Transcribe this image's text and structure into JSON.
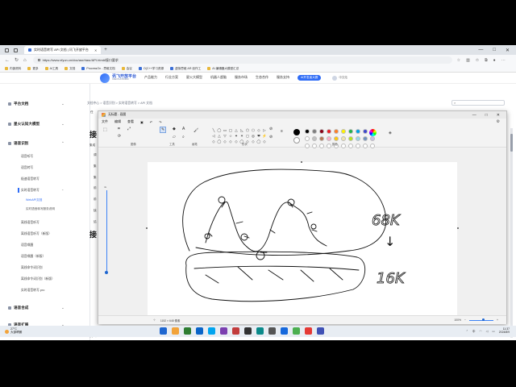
{
  "browser": {
    "tab_title": "实时语音转写 API 文档 | 讯飞开放平台",
    "new_tab_symbol": "+",
    "window_controls": [
      "—",
      "□",
      "✕"
    ],
    "url": "https://www.xfyun.cn/doc/asr/rtasr/API.html#接口要求",
    "nav_icons": [
      "back-icon",
      "forward-icon",
      "refresh-icon",
      "home-icon"
    ],
    "bookmarks": [
      "内部资料",
      "更多",
      "AI工具",
      "文档",
      "ProcessOn - 思维文档",
      "会议",
      "O(C++学习资源",
      "虚拟思维 AR 创作工",
      "AI 编辑器大模型汇总"
    ]
  },
  "site": {
    "logo_title": "讯飞开放平台",
    "logo_subtitle": "XFEI PLATFORM",
    "nav": [
      "产品能力",
      "行业方案",
      "星火大模型",
      "机器人超脑",
      "服务市场",
      "生态合作",
      "服务支持"
    ],
    "hot_label": "AI开发者大赛",
    "switch_label": "中文站"
  },
  "sidebar": {
    "sections": [
      {
        "label": "平台文档",
        "expanded": false
      },
      {
        "label": "星火认知大模型",
        "expanded": false
      },
      {
        "label": "语音识别",
        "expanded": true
      },
      {
        "label": "语音合成",
        "expanded": false
      },
      {
        "label": "语音扩展",
        "expanded": false
      }
    ],
    "asr_items": [
      "语音听写",
      "语音转写",
      "极速语音转写",
      "实时语音转写",
      "离线语音听写",
      "离线语音听写（新版）",
      "语音唤醒",
      "语音唤醒（新版）",
      "离线命令词识别",
      "离线命令词识别（新版）",
      "实时语音转写.pro"
    ],
    "active_children": [
      "WebAPI文档",
      "实时语音转写服务说明"
    ]
  },
  "content": {
    "breadcrumb": "文档中心 > 语音识别 > 实时语音转写 > API 文档",
    "search_icon": "search-icon",
    "heading_1": "接",
    "heading_2": "接",
    "heading_3": "接",
    "side_chars": [
      "集成",
      "调",
      "集",
      "集",
      "前",
      "前",
      "缺",
      "结"
    ],
    "prefix_1": "任",
    "prefix_2": "@",
    "prefix_3": "实时"
  },
  "paint": {
    "title": "无标题 - 画图",
    "window_controls": [
      "—",
      "□",
      "✕"
    ],
    "menu": [
      "文件",
      "编辑",
      "查看"
    ],
    "ribbon_labels": [
      "图像",
      "工具",
      "画笔",
      "形状",
      "颜色"
    ],
    "zoom_label": "4x",
    "status_dimensions": "1152 × 648 像素",
    "zoom_value": "100%",
    "palette": [
      "#000000",
      "#7f7f7f",
      "#880015",
      "#ed1c24",
      "#ff7f27",
      "#fff200",
      "#22b14c",
      "#00a2e8",
      "#3f48cc",
      "#a349a4",
      "#ffffff",
      "#c3c3c3",
      "#b97a57",
      "#ffaec9",
      "#ffc90e",
      "#efe4b0",
      "#b5e61d",
      "#99d9ea",
      "#7092be",
      "#c8bfe7",
      "#ffffff",
      "#ffffff",
      "#ffffff",
      "#ffffff",
      "#ffffff",
      "#ffffff",
      "#ffffff",
      "#ffffff",
      "#ffffff",
      "#ffffff"
    ],
    "shapes": [
      "╲",
      "◯",
      "▭",
      "▢",
      "△",
      "◺",
      "⬠",
      "⬡",
      "◇",
      "▷",
      "◁",
      "△",
      "▽",
      "☆",
      "✦",
      "✶",
      "◻",
      "◎",
      "❤",
      "⚡",
      "◇",
      "◯",
      "◇",
      "◇",
      "◇",
      "◯",
      "◇",
      "◇",
      "◯",
      "◇"
    ],
    "drawing_text_1": "68K",
    "drawing_text_2": "↓",
    "drawing_text_3": "16K"
  },
  "taskbar": {
    "weather_temp": "27°C",
    "weather_desc": "大部晴朗",
    "time": "11:37",
    "date": "2024/8/9",
    "tray_label": "中",
    "app_colors": [
      "#1e66d0",
      "#f2a33a",
      "#2e7d32",
      "#0a64c8",
      "#00a4ef",
      "#7b3fb0",
      "#c23c3c",
      "#333333",
      "#0b8a8a",
      "#555555",
      "#1668dc",
      "#4caf50",
      "#e53935",
      "#3f51b5"
    ]
  }
}
